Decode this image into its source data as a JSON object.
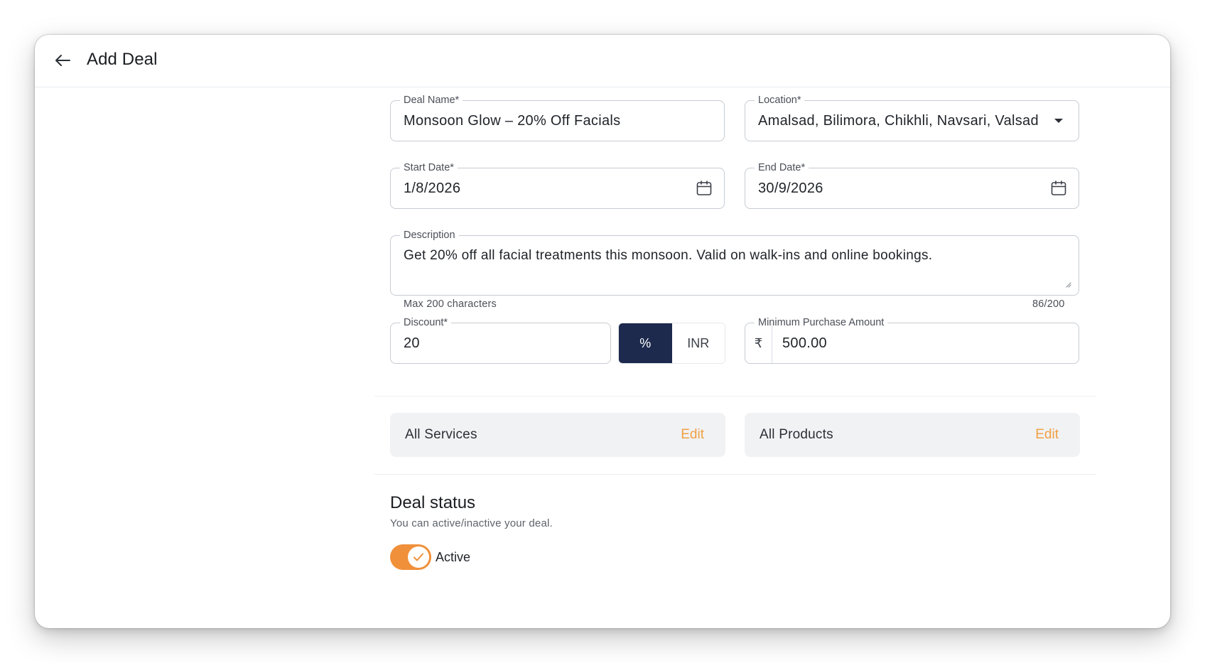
{
  "header": {
    "title": "Add Deal",
    "back_icon": "arrow-left-icon"
  },
  "form": {
    "deal_name": {
      "label": "Deal Name*",
      "value": "Monsoon Glow – 20% Off Facials"
    },
    "location": {
      "label": "Location*",
      "value": "Amalsad, Bilimora, Chikhli, Navsari, Valsad",
      "icon": "caret-down-icon"
    },
    "start_date": {
      "label": "Start Date*",
      "value": "1/8/2026",
      "icon": "calendar-icon"
    },
    "end_date": {
      "label": "End Date*",
      "value": "30/9/2026",
      "icon": "calendar-icon"
    },
    "description": {
      "label": "Description",
      "value": "Get 20% off all facial treatments this monsoon. Valid on walk-ins and online bookings.",
      "helper": "Max 200 characters",
      "counter": "86/200"
    },
    "discount": {
      "label": "Discount*",
      "value": "20",
      "options": [
        "%",
        "INR"
      ],
      "selected": "%"
    },
    "min_purchase": {
      "label": "Minimum Purchase Amount",
      "prefix": "₹",
      "value": "500.00"
    }
  },
  "scope": {
    "services": {
      "label": "All Services",
      "action": "Edit"
    },
    "products": {
      "label": "All Products",
      "action": "Edit"
    }
  },
  "status": {
    "title": "Deal status",
    "subtitle": "You can active/inactive your deal.",
    "toggle_label": "Active",
    "is_active": true
  },
  "colors": {
    "accent": "#f0903a",
    "edit_link": "#f0a043",
    "segment_active": "#1d2a4d",
    "card_bg": "#f1f2f4"
  }
}
